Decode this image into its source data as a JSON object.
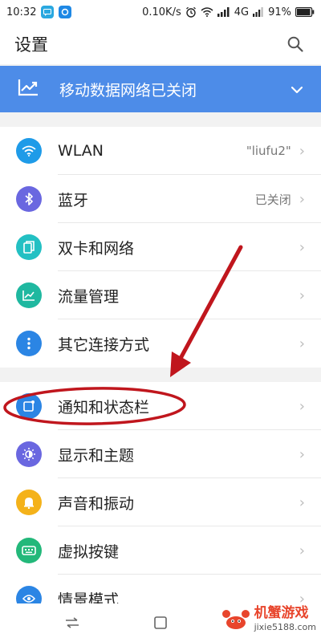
{
  "status_bar": {
    "time": "10:32",
    "speed": "0.10K/s",
    "network": "4G",
    "battery": "91%"
  },
  "header": {
    "title": "设置"
  },
  "banner": {
    "text": "移动数据网络已关闭"
  },
  "group1": [
    {
      "label": "WLAN",
      "value": "\"liufu2\"",
      "icon": "wifi-icon",
      "color": "#1e9be8"
    },
    {
      "label": "蓝牙",
      "value": "已关闭",
      "icon": "bluetooth-icon",
      "color": "#6a67e0"
    },
    {
      "label": "双卡和网络",
      "value": "",
      "icon": "sim-card-icon",
      "color": "#23c0c3"
    },
    {
      "label": "流量管理",
      "value": "",
      "icon": "data-usage-icon",
      "color": "#1fb8a0"
    },
    {
      "label": "其它连接方式",
      "value": "",
      "icon": "more-icon",
      "color": "#2b85e4"
    }
  ],
  "group2": [
    {
      "label": "通知和状态栏",
      "value": "",
      "icon": "notification-icon",
      "color": "#2b85e4"
    },
    {
      "label": "显示和主题",
      "value": "",
      "icon": "brightness-icon",
      "color": "#6a67e0"
    },
    {
      "label": "声音和振动",
      "value": "",
      "icon": "bell-icon",
      "color": "#f4b21a"
    },
    {
      "label": "虚拟按键",
      "value": "",
      "icon": "keyboard-icon",
      "color": "#23b87a"
    },
    {
      "label": "情景模式",
      "value": "",
      "icon": "scene-icon",
      "color": "#2b85e4"
    }
  ],
  "watermark": {
    "title": "机蟹游戏",
    "url": "jixie5188.com"
  },
  "colors": {
    "banner": "#4d8ce8",
    "annotation": "#c0161d"
  }
}
